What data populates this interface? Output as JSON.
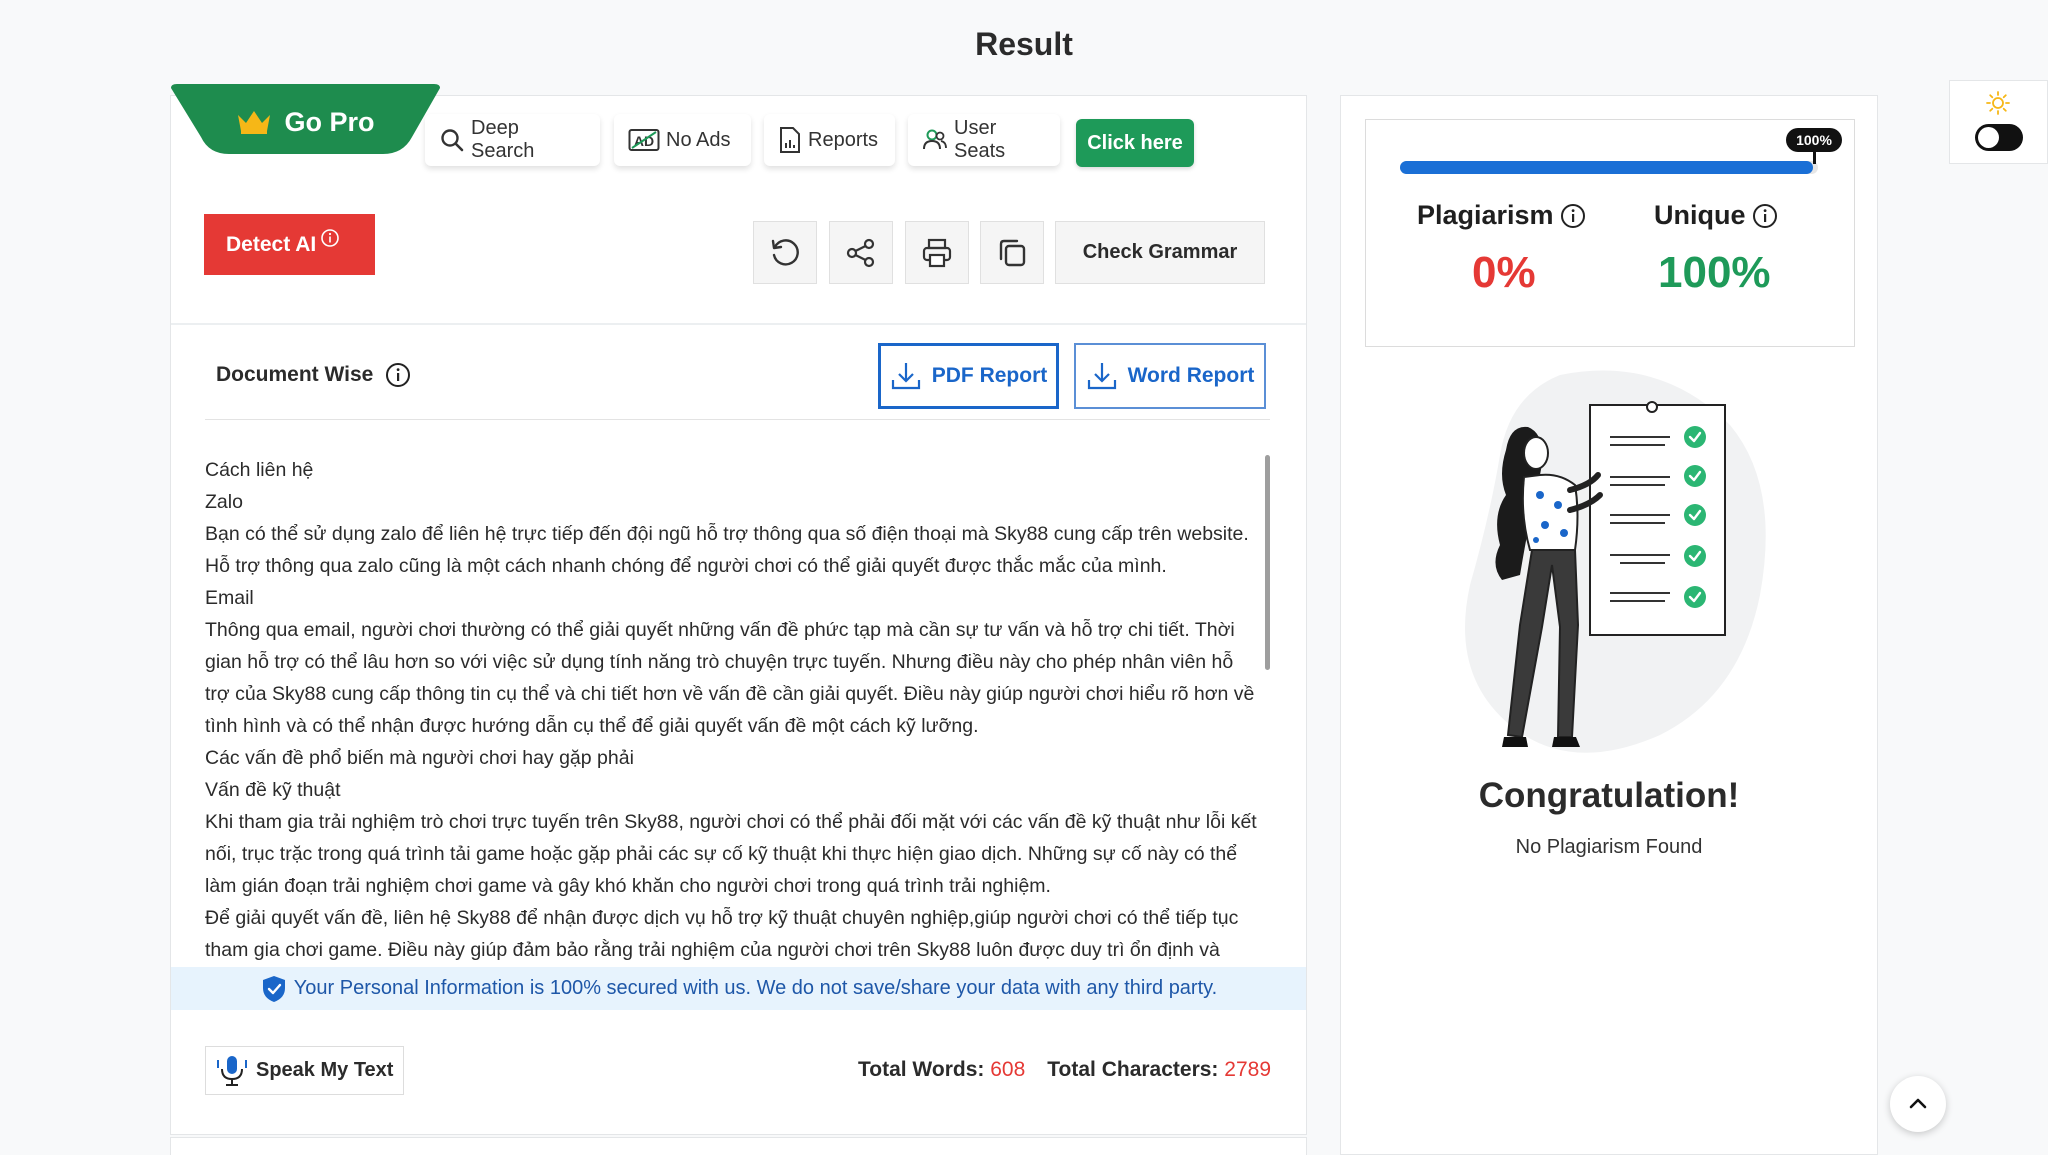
{
  "page": {
    "title": "Result"
  },
  "promo": {
    "go_pro": "Go Pro",
    "features": [
      "Deep Search",
      "No Ads",
      "Reports",
      "User Seats"
    ],
    "click_here": "Click here"
  },
  "toolbar": {
    "detect_ai": "Detect AI",
    "check_grammar": "Check Grammar"
  },
  "document": {
    "heading": "Document Wise",
    "pdf_report": "PDF Report",
    "word_report": "Word Report",
    "paragraphs": [
      "Cách liên hệ",
      "Zalo",
      "Bạn có thể sử dụng zalo để liên hệ trực tiếp đến đội ngũ hỗ trợ thông qua số điện thoại mà Sky88 cung cấp trên website. Hỗ trợ thông qua zalo cũng là một cách nhanh chóng để người chơi có thể giải quyết được thắc mắc của mình.",
      "Email",
      "Thông qua email, người chơi thường có thể giải quyết những vấn đề phức tạp mà cần sự tư vấn và hỗ trợ chi tiết. Thời gian hỗ trợ có thể lâu hơn so với việc sử dụng tính năng trò chuyện trực tuyến. Nhưng điều này cho phép nhân viên hỗ trợ của Sky88 cung cấp thông tin cụ thể và chi tiết hơn về vấn đề cần giải quyết. Điều này giúp người chơi hiểu rõ hơn về tình hình và có thể nhận được hướng dẫn cụ thể để giải quyết vấn đề một cách kỹ lưỡng.",
      "Các vấn đề phổ biến mà người chơi hay gặp phải",
      "Vấn đề kỹ thuật",
      "Khi tham gia trải nghiệm trò chơi trực tuyến trên Sky88, người chơi có thể phải đối mặt với các vấn đề kỹ thuật như lỗi kết nối, trục trặc trong quá trình tải game hoặc gặp phải các sự cố kỹ thuật khi thực hiện giao dịch. Những sự cố này có thể làm gián đoạn trải nghiệm chơi game và gây khó khăn cho người chơi trong quá trình trải nghiệm.",
      "Để giải quyết vấn đề, liên hệ Sky88 để nhận được dịch vụ hỗ trợ kỹ thuật chuyên nghiệp,giúp người chơi có thể tiếp tục tham gia chơi game. Điều này giúp đảm bảo rằng trải nghiệm của người chơi trên Sky88 luôn được duy trì ổn định và"
    ]
  },
  "security_notice": "Your Personal Information is 100% secured with us. We do not save/share your data with any third party.",
  "footer": {
    "speak": "Speak My Text",
    "words_label": "Total Words:",
    "words_value": "608",
    "chars_label": "Total Characters:",
    "chars_value": "2789"
  },
  "result": {
    "progress_label": "100%",
    "progress_fraction": 1.0,
    "plagiarism_label": "Plagiarism",
    "plagiarism_value": "0%",
    "unique_label": "Unique",
    "unique_value": "100%",
    "congrats": "Congratulation!",
    "message": "No Plagiarism Found"
  },
  "colors": {
    "brand_green": "#1e9a59",
    "danger_red": "#e53935",
    "link_blue": "#1a66c9"
  },
  "icons": [
    "crown-icon",
    "search-icon",
    "ad-icon",
    "report-icon",
    "users-icon",
    "info-icon",
    "refresh-icon",
    "share-icon",
    "print-icon",
    "copy-icon",
    "download-icon",
    "shield-icon",
    "microphone-icon",
    "sun-icon",
    "chevron-up-icon"
  ]
}
